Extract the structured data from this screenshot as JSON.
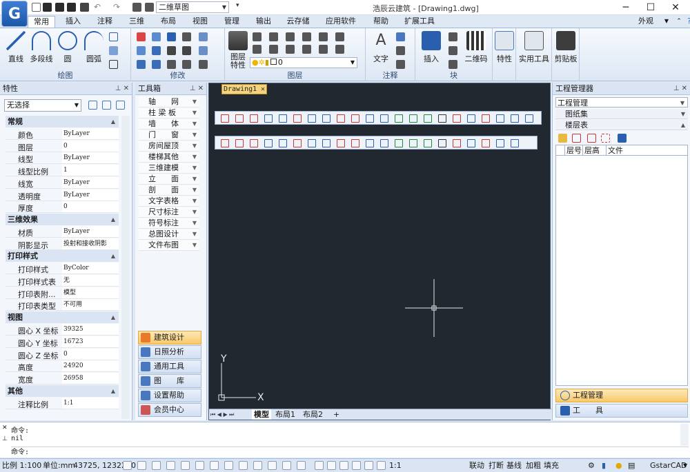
{
  "window": {
    "title": "浩辰云建筑 - [Drawing1.dwg]",
    "workspace": "二维草图",
    "logo": "G",
    "appearance": "外观"
  },
  "tabs": [
    "常用",
    "插入",
    "注释",
    "三维",
    "布局",
    "视图",
    "管理",
    "输出",
    "云存储",
    "应用软件",
    "帮助",
    "扩展工具"
  ],
  "ribbon": {
    "draw": {
      "name": "绘图",
      "tools": [
        "直线",
        "多段线",
        "圆",
        "圆弧"
      ]
    },
    "modify": {
      "name": "修改"
    },
    "layer": {
      "name": "图层",
      "big": "图层特性",
      "combo": "0"
    },
    "annotate": {
      "name": "注释",
      "big": "文字"
    },
    "block": {
      "name": "块",
      "tools": [
        "插入",
        "二维码"
      ]
    },
    "props": {
      "big": "特性"
    },
    "utils": {
      "big": "实用工具"
    },
    "clipboard": {
      "big": "剪贴板"
    }
  },
  "properties": {
    "title": "特性",
    "selection": "无选择",
    "sections": [
      {
        "name": "常规",
        "rows": [
          [
            "颜色",
            "ByLayer"
          ],
          [
            "图层",
            "0"
          ],
          [
            "线型",
            "ByLayer"
          ],
          [
            "线型比例",
            "1"
          ],
          [
            "线宽",
            "ByLayer"
          ],
          [
            "透明度",
            "ByLayer"
          ],
          [
            "厚度",
            "0"
          ]
        ]
      },
      {
        "name": "三维效果",
        "rows": [
          [
            "材质",
            "ByLayer"
          ],
          [
            "阴影显示",
            "投射和接收阴影"
          ]
        ]
      },
      {
        "name": "打印样式",
        "rows": [
          [
            "打印样式",
            "ByColor"
          ],
          [
            "打印样式表",
            "无"
          ],
          [
            "打印表附...",
            "模型"
          ],
          [
            "打印表类型",
            "不可用"
          ]
        ]
      },
      {
        "name": "视图",
        "rows": [
          [
            "圆心 X 坐标",
            "39325"
          ],
          [
            "圆心 Y 坐标",
            "16723"
          ],
          [
            "圆心 Z 坐标",
            "0"
          ],
          [
            "高度",
            "24920"
          ],
          [
            "宽度",
            "26958"
          ]
        ]
      },
      {
        "name": "其他",
        "rows": [
          [
            "注释比例",
            "1:1"
          ]
        ]
      }
    ]
  },
  "toolbox": {
    "title": "工具箱",
    "items": [
      "轴　　网",
      "柱 梁 板",
      "墙　　体",
      "门　　窗",
      "房间屋顶",
      "楼梯其他",
      "三维建模",
      "立　　面",
      "剖　　面",
      "文字表格",
      "尺寸标注",
      "符号标注",
      "总图设计",
      "文件布图"
    ],
    "buttons": [
      "建筑设计",
      "日照分析",
      "通用工具",
      "图　　库",
      "设置帮助",
      "会员中心"
    ]
  },
  "drawing": {
    "doc_tab": "Drawing1",
    "layout_tabs": [
      "模型",
      "布局1",
      "布局2",
      "+"
    ],
    "axis_y": "Y",
    "axis_x": "X"
  },
  "project": {
    "title": "工程管理器",
    "dropdown": "工程管理",
    "rows": [
      "图纸集",
      "楼层表"
    ],
    "columns": [
      "层号",
      "层高",
      "文件"
    ],
    "buttons": [
      "工程管理",
      "工　　具"
    ]
  },
  "command": {
    "lines": [
      "命令:",
      "nil"
    ],
    "prompt": "命令:"
  },
  "status": {
    "scale": "比例 1:100",
    "unit": "单位:mm",
    "coords": "43725, 12322, 0",
    "osnap": "1:1",
    "labels": [
      "联动",
      "打断",
      "基线",
      "加粗",
      "填充"
    ],
    "brand": "GstarCAD"
  }
}
